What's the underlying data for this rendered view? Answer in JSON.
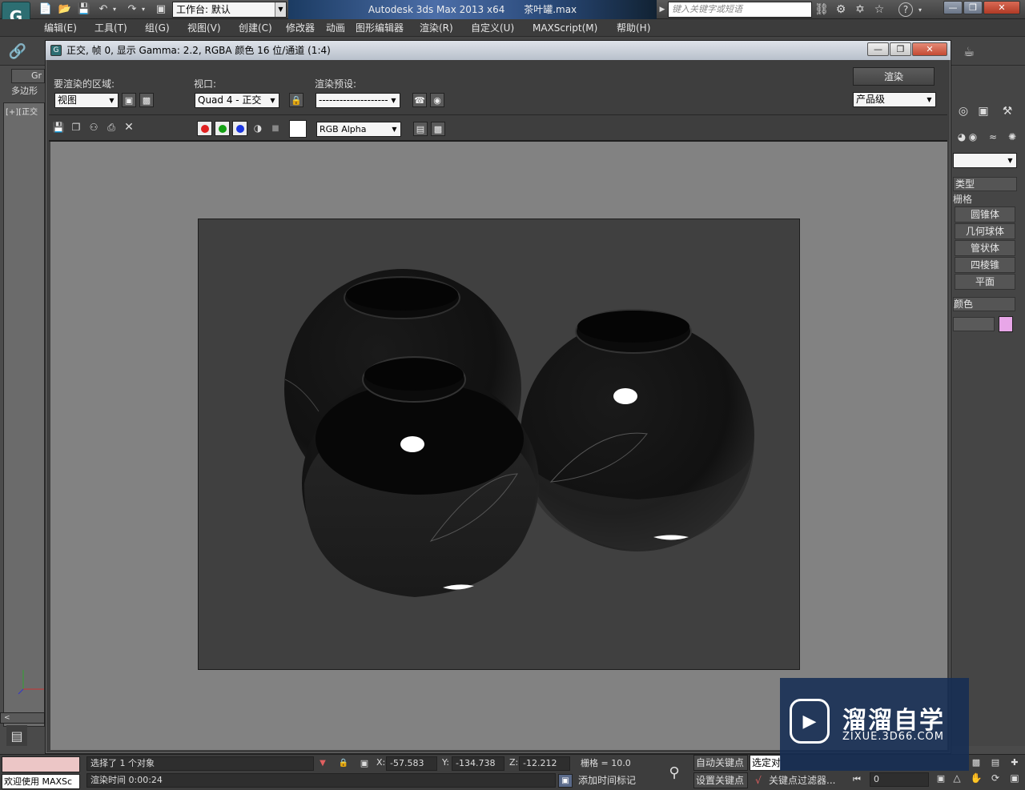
{
  "app": {
    "title_product": "Autodesk 3ds Max  2013 x64",
    "title_file": "茶叶罐.max",
    "workspace_label": "工作台: 默认",
    "search_placeholder": "键入关键字或短语"
  },
  "menu": [
    "编辑(E)",
    "工具(T)",
    "组(G)",
    "视图(V)",
    "创建(C)",
    "修改器",
    "动画",
    "图形编辑器",
    "渲染(R)",
    "自定义(U)",
    "MAXScript(M)",
    "帮助(H)"
  ],
  "left": {
    "tab1": "Gr",
    "tab2": "多边形",
    "viewport_label": "[+][正交"
  },
  "render_window": {
    "title": "正交, 帧 0, 显示 Gamma: 2.2, RGBA 颜色 16 位/通道 (1:4)",
    "area_label": "要渲染的区域:",
    "area_value": "视图",
    "viewport_label": "视口:",
    "viewport_value": "Quad 4 - 正交",
    "preset_label": "渲染预设:",
    "preset_value": "--------------------",
    "render_button": "渲染",
    "quality_value": "产品级",
    "channel_value": "RGB Alpha"
  },
  "command_panel": {
    "type_header": "类型",
    "grid_label": "栅格",
    "items": [
      "圆锥体",
      "几何球体",
      "管状体",
      "四棱锥",
      "平面"
    ],
    "color_header": "颜色",
    "color_swatch": "#e8a6e8"
  },
  "status": {
    "selection": "选择了 1 个对象",
    "welcome": "欢迎使用 MAXSc",
    "render_time": "渲染时间  0:00:24",
    "x_label": "X:",
    "x_value": "-57.583",
    "y_label": "Y:",
    "y_value": "-134.738",
    "z_label": "Z:",
    "z_value": "-12.212",
    "grid": "栅格 = 10.0",
    "add_time_tag": "添加时间标记",
    "auto_key": "自动关键点",
    "selected_obj": "选定对",
    "set_key": "设置关键点",
    "key_filter": "关键点过滤器...",
    "frame_value": "0"
  },
  "watermark": {
    "cn": "溜溜自学",
    "url": "ZIXUE.3D66.COM"
  }
}
